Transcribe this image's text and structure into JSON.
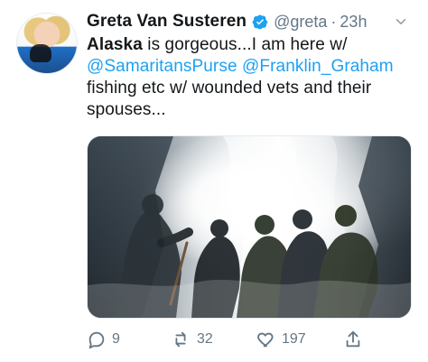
{
  "tweet": {
    "author": {
      "name": "Greta Van Susteren",
      "handle": "@greta",
      "separator": "·",
      "time": "23h",
      "verified": true
    },
    "text": {
      "line1_bold": "Alaska",
      "line1_rest": " is gorgeous...I am here w/",
      "mention1": "@SamaritansPurse",
      "mention2": "@Franklin_Graham",
      "rest": "fishing etc w/ wounded vets and their spouses..."
    },
    "media": {
      "type": "photo",
      "alt": ""
    },
    "actions": {
      "replies": "9",
      "retweets": "32",
      "likes": "197"
    },
    "colors": {
      "link": "#1da1f2",
      "secondary_text": "#657786",
      "primary_text": "#14171a"
    },
    "icons": {
      "verified": "verified-badge-icon",
      "more": "chevron-down-icon",
      "reply": "reply-icon",
      "retweet": "retweet-icon",
      "like": "heart-icon",
      "share": "share-icon"
    }
  }
}
